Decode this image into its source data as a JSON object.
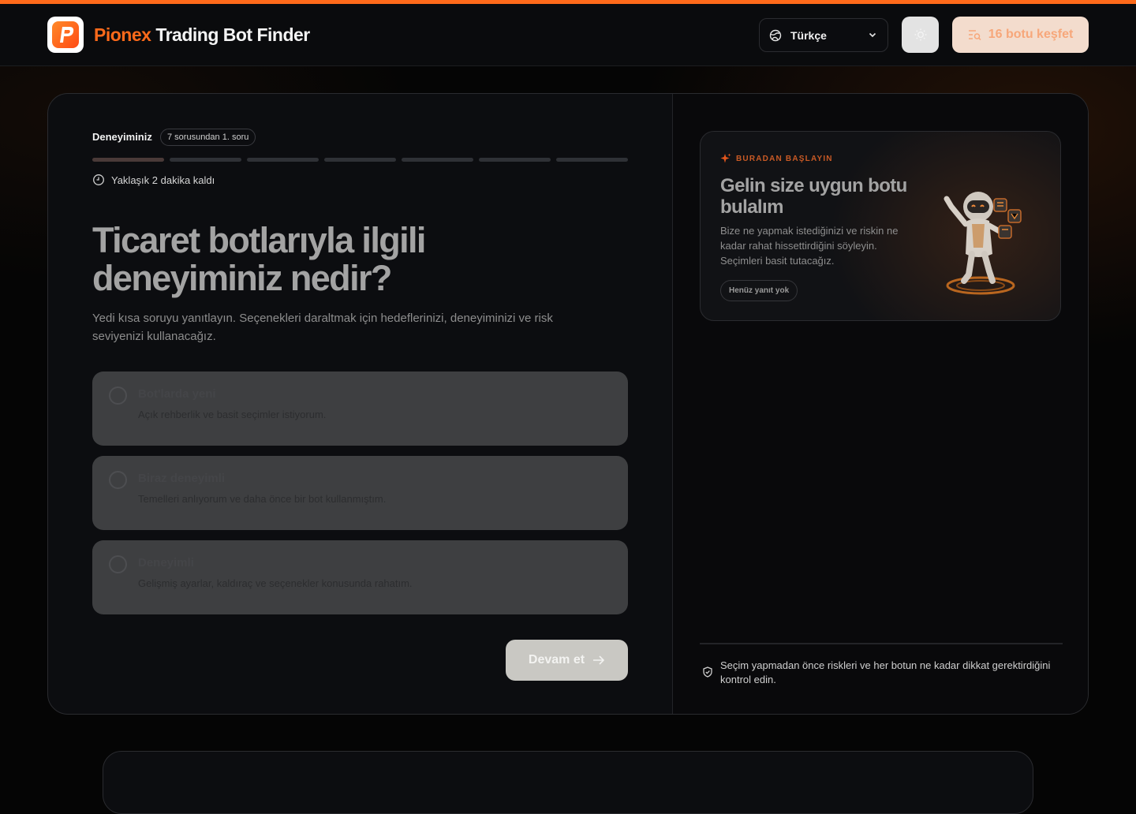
{
  "colors": {
    "accent": "#ff6a1a",
    "background": "#050505",
    "card": "#0c0d10"
  },
  "header": {
    "brand_highlight": "Pionex",
    "brand_rest": "Trading Bot Finder",
    "language": {
      "selected": "Türkçe",
      "icon": "globe-icon"
    },
    "theme_toggle_icon": "sun-icon",
    "explore_button": "16 botu keşfet"
  },
  "quiz": {
    "step_title": "Deneyiminiz",
    "step_count": "7 sorusundan 1. soru",
    "progress": {
      "total_steps": 7,
      "current_step": 1
    },
    "eta": "Yaklaşık 2 dakika kaldı",
    "question": "Ticaret botlarıyla ilgili deneyiminiz nedir?",
    "subtext": "Yedi kısa soruyu yanıtlayın. Seçenekleri daraltmak için hedeflerinizi, deneyiminizi ve risk seviyenizi kullanacağız.",
    "options": [
      {
        "title": "Bot'larda yeni",
        "description": "Açık rehberlik ve basit seçimler istiyorum."
      },
      {
        "title": "Biraz deneyimli",
        "description": "Temelleri anlıyorum ve daha önce bir bot kullanmıştım."
      },
      {
        "title": "Deneyimli",
        "description": "Gelişmiş ayarlar, kaldıraç ve seçenekler konusunda rahatım."
      }
    ],
    "continue_label": "Devam et"
  },
  "sidebar": {
    "kicker": "BURADAN BAŞLAYIN",
    "title": "Gelin size uygun botu bulalım",
    "description": "Bize ne yapmak istediğinizi ve riskin ne kadar rahat hissettirdiğini söyleyin. Seçimleri basit tutacağız.",
    "status_pill": "Henüz yanıt yok",
    "note": "Seçim yapmadan önce riskleri ve her botun ne kadar dikkat gerektirdiğini kontrol edin."
  }
}
